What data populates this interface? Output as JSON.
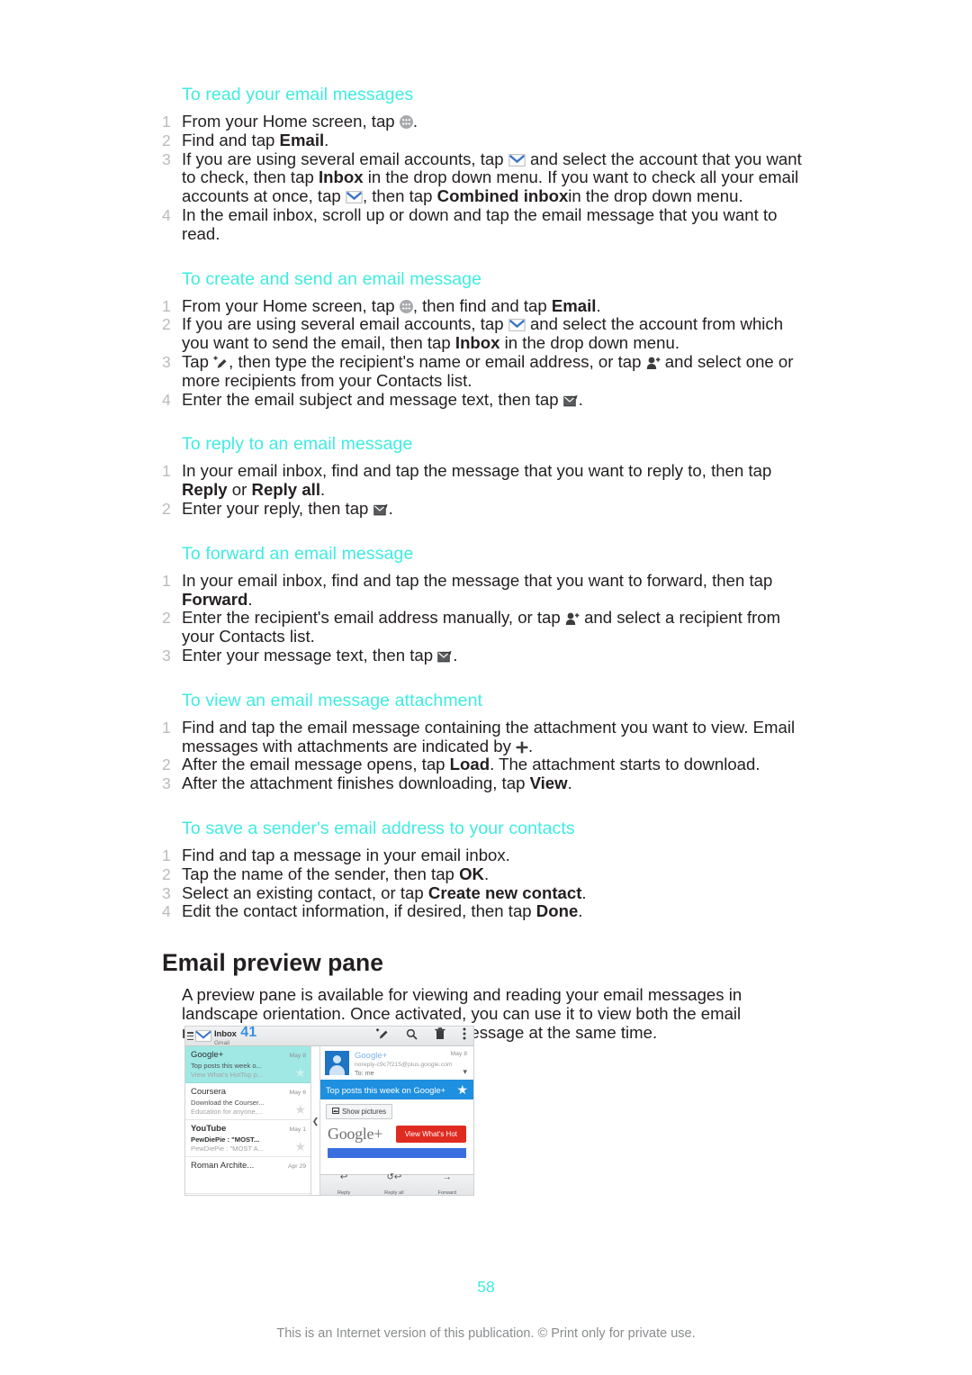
{
  "document": {
    "page_number": "58",
    "footer_note": "This is an Internet version of this publication. © Print only for private use."
  },
  "sections": [
    {
      "heading": "To read your email messages",
      "steps": [
        "From your Home screen, tap [appdrawer].",
        "Find and tap <b>Email</b>.",
        "If you are using several email accounts, tap [envelope] and select the account that you want to check, then tap <b>Inbox</b> in the drop down menu. If you want to check all your email accounts at once, tap [envelope], then tap <b>Combined inbox</b>in the drop down menu.",
        "In the email inbox, scroll up or down and tap the email message that you want to read."
      ]
    },
    {
      "heading": "To create and send an email message",
      "steps": [
        "From your Home screen, tap [appdrawer], then find and tap <b>Email</b>.",
        "If you are using several email accounts, tap [envelope] and select the account from which you want to send the email, then tap <b>Inbox</b> in the drop down menu.",
        "Tap [compose], then type the recipient's name or email address, or tap [addcontact] and select one or more recipients from your Contacts list.",
        "Enter the email subject and message text, then tap [send]."
      ]
    },
    {
      "heading": "To reply to an email message",
      "steps": [
        "In your email inbox, find and tap the message that you want to reply to, then tap <b>Reply</b> or <b>Reply all</b>.",
        "Enter your reply, then tap [send]."
      ]
    },
    {
      "heading": "To forward an email message",
      "steps": [
        "In your email inbox, find and tap the message that you want to forward, then tap <b>Forward</b>.",
        "Enter the recipient's email address manually, or tap [addcontact] and select a recipient from your Contacts list.",
        "Enter your message text, then tap [send]."
      ]
    },
    {
      "heading": "To view an email message attachment",
      "steps": [
        "Find and tap the email message containing the attachment you want to view. Email messages with attachments are indicated by [plus].",
        "After the email message opens, tap <b>Load</b>. The attachment starts to download.",
        "After the attachment finishes downloading, tap <b>View</b>."
      ]
    },
    {
      "heading": "To save a sender's email address to your contacts",
      "steps": [
        "Find and tap a message in your email inbox.",
        "Tap the name of the sender, then tap <b>OK</b>.",
        "Select an existing contact, or tap <b>Create new contact</b>.",
        "Edit the contact information, if desired, then tap <b>Done</b>."
      ]
    }
  ],
  "preview_pane": {
    "title": "Email preview pane",
    "body": "A preview pane is available for viewing and reading your email messages in landscape orientation. Once activated, you can use it to view both the email message list and one selected email message at the same time."
  },
  "screenshot": {
    "action_bar": {
      "menu_icon": "hamburger-icon",
      "account_icon": "envelope-icon",
      "title": "Inbox",
      "count": "41",
      "subtitle": "Gmail",
      "actions": [
        {
          "name": "compose-icon",
          "glyph": "compose"
        },
        {
          "name": "search-icon",
          "glyph": "search"
        },
        {
          "name": "delete-icon",
          "glyph": "trash"
        },
        {
          "name": "overflow-menu-icon",
          "glyph": "kebab"
        }
      ]
    },
    "message_list": [
      {
        "sender": "Google+",
        "date": "May 8",
        "subject": "Top posts this week o...",
        "snippet": "View What's HotTop p...",
        "selected": true,
        "unread": false,
        "starred": true
      },
      {
        "sender": "Coursera",
        "date": "May 6",
        "subject": "Download the Courser...",
        "snippet": "Education for anyone,...",
        "selected": false,
        "unread": false,
        "starred": false
      },
      {
        "sender": "YouTube",
        "date": "May 1",
        "subject": "PewDiePie : \"MOST...",
        "snippet": "PewDiePie : \"MOST A...",
        "selected": false,
        "unread": true,
        "starred": false
      },
      {
        "sender": "Roman Archite...",
        "date": "Apr 29",
        "subject": "",
        "snippet": "",
        "selected": false,
        "unread": false,
        "starred": false
      }
    ],
    "reader": {
      "from": "Google+",
      "date": "May 8",
      "address": "noreply-c9c7f215@plus.google.com",
      "to": "To: me",
      "subject": "Top posts this week on Google+",
      "show_pictures_label": "Show pictures",
      "brand_logo": "Google+",
      "cta_label": "View What's Hot",
      "footer_buttons": [
        {
          "icon": "reply-icon",
          "label": "Reply"
        },
        {
          "icon": "reply-all-icon",
          "label": "Reply all"
        },
        {
          "icon": "forward-icon",
          "label": "Forward"
        }
      ]
    },
    "colors": {
      "selected_row": "#9fe8e4",
      "subject_bar": "#1f8fe0",
      "cta_red": "#e02b20",
      "band_blue": "#3b6fe0",
      "heading_cyan": "#3fece0"
    }
  }
}
